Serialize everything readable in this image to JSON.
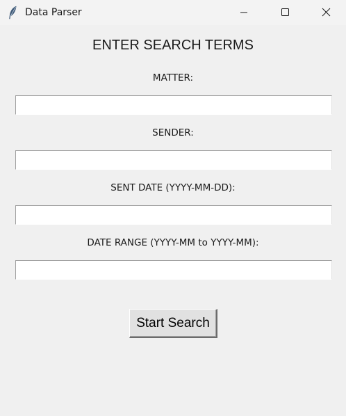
{
  "window": {
    "title": "Data Parser",
    "app_icon": "feather-icon",
    "controls": {
      "minimize_icon": "minimize-icon",
      "maximize_icon": "maximize-icon",
      "close_icon": "close-icon"
    }
  },
  "form": {
    "heading": "ENTER SEARCH TERMS",
    "fields": [
      {
        "label": "MATTER:",
        "value": ""
      },
      {
        "label": "SENDER:",
        "value": ""
      },
      {
        "label": "SENT DATE (YYYY-MM-DD):",
        "value": ""
      },
      {
        "label": "DATE RANGE (YYYY-MM to YYYY-MM):",
        "value": ""
      }
    ],
    "submit_label": "Start Search"
  },
  "colors": {
    "window_background": "#f0f0f0",
    "titlebar_background": "#f3f3f3",
    "entry_background": "#ffffff",
    "button_background": "#e1e1e1"
  }
}
